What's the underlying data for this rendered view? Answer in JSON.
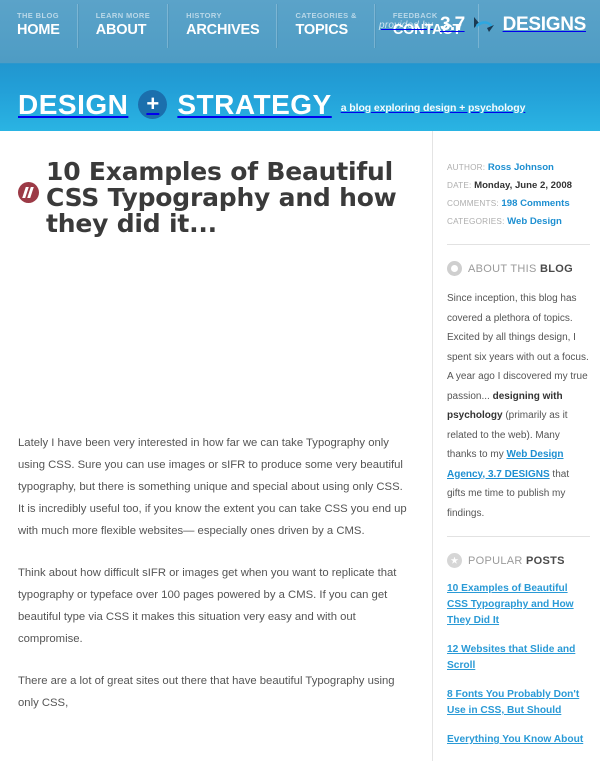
{
  "header": {
    "nav": [
      {
        "kicker": "THE BLOG",
        "label": "HOME"
      },
      {
        "kicker": "LEARN MORE",
        "label": "ABOUT"
      },
      {
        "kicker": "HISTORY",
        "label": "ARCHIVES"
      },
      {
        "kicker": "CATEGORIES &",
        "label": "TOPICS"
      },
      {
        "kicker": "FEEDBACK",
        "label": "CONTACT"
      }
    ],
    "provided_by_text": "provided by",
    "brand_number": "3.7",
    "brand_name": "DESIGNS",
    "logo_word_1": "DESIGN",
    "logo_plus": "+",
    "logo_word_2": "STRATEGY",
    "logo_tagline": "a blog exploring design + psychology",
    "colors": {
      "nav_band": "#4e9cc4",
      "hero_band": "#2196cf",
      "plus_circle": "#1b6fad"
    }
  },
  "post": {
    "title": "10 Examples of Beautiful CSS Typography and how they did it...",
    "badge_glyph": "//",
    "paragraphs": [
      "Lately I have been very interested in how far we can take Typography only using CSS. Sure you can use images or sIFR to produce some very beautiful typography, but there is something unique and special about using only CSS. It is incredibly useful too, if you know the extent you can take CSS you end up with much more flexible websites— especially ones driven by a CMS.",
      "Think about how difficult sIFR or images get when you want to replicate that typography or typeface over 100 pages powered by a CMS. If you can get beautiful type via CSS it makes this situation very easy and with out compromise.",
      "There are a lot of great sites out there that have beautiful Typography using only CSS,"
    ]
  },
  "sidebar": {
    "meta": [
      {
        "label": "AUTHOR:",
        "value": "Ross Johnson",
        "is_link": true
      },
      {
        "label": "DATE:",
        "value": "Monday, June 2, 2008",
        "is_link": false
      },
      {
        "label": "COMMENTS:",
        "value": "198 Comments",
        "is_link": true
      },
      {
        "label": "CATEGORIES:",
        "value": "Web Design",
        "is_link": true
      }
    ],
    "about": {
      "heading_light": "ABOUT THIS ",
      "heading_bold": "BLOG",
      "text_1": "Since inception, this blog has covered a plethora of topics. Excited by all things design, I spent six years with out a focus. A year ago I discovered my true passion... ",
      "text_bold": "designing with psychology",
      "text_2": " (primarily as it related to the web). Many thanks to my ",
      "link_text": "Web Design Agency, 3.7 DESIGNS",
      "text_3": " that gifts me time to publish my findings."
    },
    "popular": {
      "heading_light": "POPULAR ",
      "heading_bold": "POSTS",
      "items": [
        "10 Examples of Beautiful CSS Typography and How They Did It",
        "12 Websites that Slide and Scroll",
        "8 Fonts You Probably Don't Use in CSS, But Should",
        "Everything You Know About"
      ]
    }
  }
}
